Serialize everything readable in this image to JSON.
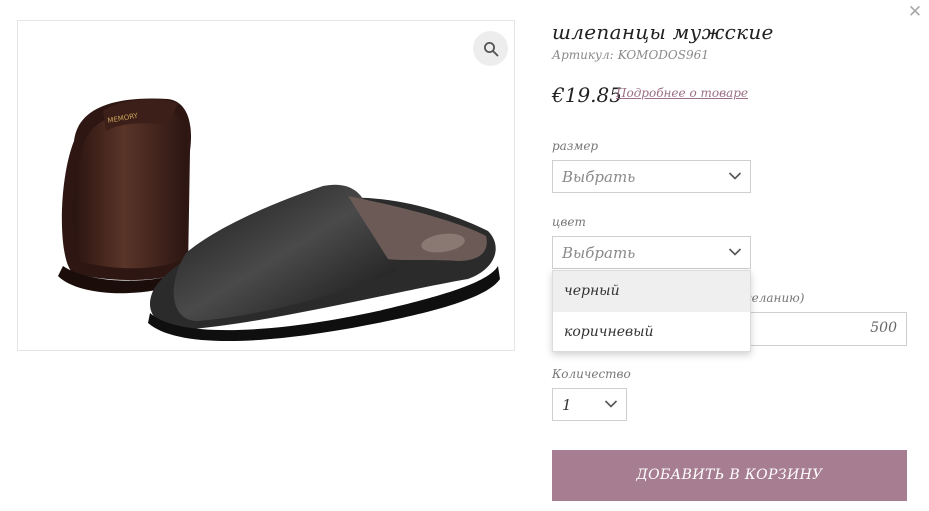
{
  "product": {
    "title": "шлепанцы мужские",
    "sku_label": "Артикул:",
    "sku_value": "KOMODOS961",
    "price": "€19.85",
    "details_link": "Подробнее о товаре",
    "image_alt": "Кожаные мужские шлепанцы, пара",
    "insole_brand": "MEMORY"
  },
  "options": {
    "size": {
      "label": "размер",
      "value": "Выбрать"
    },
    "color": {
      "label": "цвет",
      "value": "Выбрать",
      "options": [
        "черный",
        "коричневый"
      ],
      "highlighted": "черный"
    },
    "custom_price": {
      "label_partial": "желанию)",
      "value": "500"
    },
    "quantity": {
      "label": "Количество",
      "value": "1"
    }
  },
  "actions": {
    "add_to_cart": "ДОБАВИТЬ В КОРЗИНУ"
  },
  "icons": {
    "close": "close-icon",
    "zoom": "search-icon",
    "chevron": "chevron-down-icon"
  },
  "colors": {
    "accent": "#a77e91",
    "link": "#9a7086",
    "border": "#cfcfcf"
  }
}
